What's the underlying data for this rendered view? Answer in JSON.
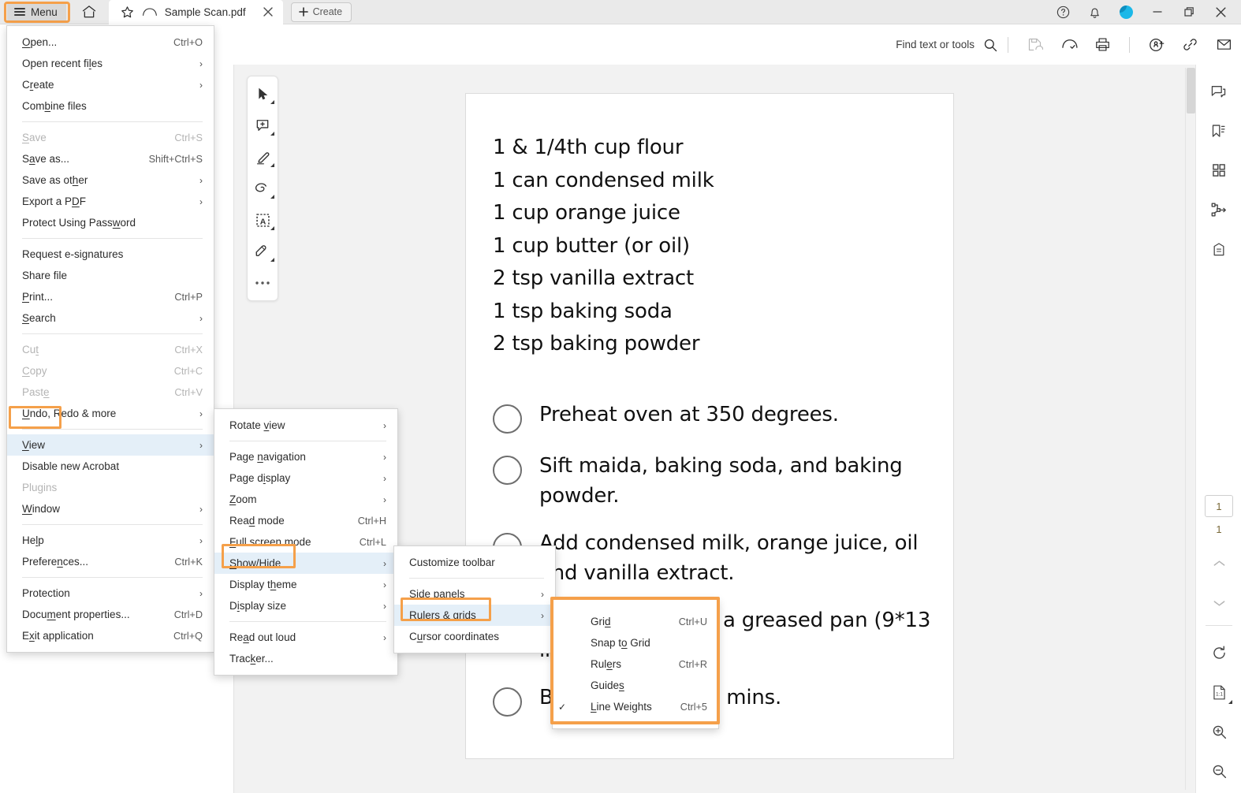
{
  "window": {
    "title_bar": {
      "menu_label": "Menu",
      "home_icon": "home-icon",
      "tab": {
        "star_icon": "star-icon",
        "cloud_icon": "cloud-icon",
        "title": "Sample Scan.pdf",
        "close_icon": "close-icon"
      },
      "create_label": "Create",
      "right_icons": [
        "help-icon",
        "bell-icon",
        "avatar"
      ],
      "window_controls": [
        "minimize",
        "restore",
        "close"
      ]
    },
    "toolbar": {
      "find_placeholder": "Find text or tools",
      "search_icon": "search-icon",
      "icons": [
        "save-to-cloud-icon",
        "cloud-sync-icon",
        "print-icon",
        "request-signature-icon",
        "link-icon",
        "email-icon"
      ]
    }
  },
  "tool_palette": {
    "items": [
      {
        "name": "select-tool",
        "icon": "cursor-arrow-icon",
        "has_caret": true
      },
      {
        "name": "comment-tool",
        "icon": "add-comment-icon",
        "has_caret": true
      },
      {
        "name": "highlight-tool",
        "icon": "highlighter-icon",
        "has_caret": true
      },
      {
        "name": "draw-tool",
        "icon": "lasso-draw-icon",
        "has_caret": true
      },
      {
        "name": "text-select-tool",
        "icon": "select-text-box-icon",
        "has_caret": true
      },
      {
        "name": "fill-sign-tool",
        "icon": "fill-and-sign-icon",
        "has_caret": true
      },
      {
        "name": "more-tools",
        "icon": "ellipsis-icon",
        "has_caret": false
      }
    ]
  },
  "main_menu": {
    "items": [
      {
        "label": "Open...",
        "mnemonic": "O",
        "accel": "Ctrl+O"
      },
      {
        "label": "Open recent files",
        "mnemonic": "l",
        "arrow": true
      },
      {
        "label": "Create",
        "mnemonic": "r",
        "arrow": true
      },
      {
        "label": "Combine files",
        "mnemonic": "b"
      },
      {
        "sep": true
      },
      {
        "label": "Save",
        "mnemonic": "S",
        "accel": "Ctrl+S",
        "disabled": true
      },
      {
        "label": "Save as...",
        "mnemonic": "a",
        "accel": "Shift+Ctrl+S"
      },
      {
        "label": "Save as other",
        "mnemonic": "h",
        "arrow": true
      },
      {
        "label": "Export a PDF",
        "mnemonic": "D",
        "arrow": true
      },
      {
        "label": "Protect Using Password",
        "mnemonic": "w"
      },
      {
        "sep": true
      },
      {
        "label": "Request e-signatures"
      },
      {
        "label": "Share file"
      },
      {
        "label": "Print...",
        "mnemonic": "P",
        "accel": "Ctrl+P"
      },
      {
        "label": "Search",
        "mnemonic": "S",
        "arrow": true
      },
      {
        "sep": true
      },
      {
        "label": "Cut",
        "mnemonic": "t",
        "accel": "Ctrl+X",
        "disabled": true
      },
      {
        "label": "Copy",
        "mnemonic": "C",
        "accel": "Ctrl+C",
        "disabled": true
      },
      {
        "label": "Paste",
        "mnemonic": "e",
        "accel": "Ctrl+V",
        "disabled": true
      },
      {
        "label": "Undo, Redo & more",
        "mnemonic": "U",
        "arrow": true
      },
      {
        "sep": true
      },
      {
        "label": "View",
        "mnemonic": "V",
        "arrow": true,
        "selected": true
      },
      {
        "label": "Disable new Acrobat"
      },
      {
        "label": "Plugins",
        "disabled": true
      },
      {
        "label": "Window",
        "mnemonic": "W",
        "arrow": true
      },
      {
        "sep": true
      },
      {
        "label": "Help",
        "mnemonic": "l",
        "arrow": true
      },
      {
        "label": "Preferences...",
        "mnemonic": "n",
        "accel": "Ctrl+K"
      },
      {
        "sep": true
      },
      {
        "label": "Protection",
        "arrow": true
      },
      {
        "label": "Document properties...",
        "mnemonic": "m",
        "accel": "Ctrl+D"
      },
      {
        "label": "Exit application",
        "mnemonic": "x",
        "accel": "Ctrl+Q"
      }
    ]
  },
  "view_menu": {
    "items": [
      {
        "label": "Rotate view",
        "mnemonic": "v",
        "arrow": true
      },
      {
        "sep": true
      },
      {
        "label": "Page navigation",
        "mnemonic": "n",
        "arrow": true
      },
      {
        "label": "Page display",
        "mnemonic": "i",
        "arrow": true
      },
      {
        "label": "Zoom",
        "mnemonic": "Z",
        "arrow": true
      },
      {
        "label": "Read mode",
        "mnemonic": "d",
        "accel": "Ctrl+H"
      },
      {
        "label": "Full screen mode",
        "mnemonic": "F",
        "accel": "Ctrl+L"
      },
      {
        "label": "Show/Hide",
        "mnemonic": "S",
        "arrow": true,
        "selected": true
      },
      {
        "label": "Display theme",
        "mnemonic": "h",
        "arrow": true
      },
      {
        "label": "Display size",
        "mnemonic": "i",
        "arrow": true
      },
      {
        "sep": true
      },
      {
        "label": "Read out loud",
        "mnemonic": "a",
        "arrow": true
      },
      {
        "label": "Tracker...",
        "mnemonic": "k"
      }
    ]
  },
  "showhide_menu": {
    "items": [
      {
        "label": "Customize toolbar"
      },
      {
        "sep": true
      },
      {
        "label": "Side panels",
        "arrow": true
      },
      {
        "label": "Rulers & grids",
        "mnemonic": "R",
        "arrow": true,
        "selected": true
      },
      {
        "label": "Cursor coordinates",
        "mnemonic": "u"
      }
    ]
  },
  "rulers_grids_menu": {
    "items": [
      {
        "label": "Grid",
        "mnemonic": "d",
        "accel": "Ctrl+U",
        "checked": false
      },
      {
        "label": "Snap to Grid",
        "mnemonic": "o",
        "checked": false
      },
      {
        "label": "Rulers",
        "mnemonic": "e",
        "accel": "Ctrl+R",
        "checked": false
      },
      {
        "label": "Guides",
        "mnemonic": "s",
        "checked": false
      },
      {
        "label": "Line Weights",
        "mnemonic": "L",
        "accel": "Ctrl+5",
        "checked": true
      }
    ]
  },
  "document": {
    "ingredients": [
      "1 & 1/4th cup flour",
      "1 can condensed milk",
      "1 cup orange juice",
      "1 cup butter (or oil)",
      "2 tsp vanilla extract",
      "1 tsp baking soda",
      "2 tsp baking powder"
    ],
    "steps": [
      "Preheat oven at 350 degrees.",
      "Sift maida, baking soda, and baking powder.",
      "Add condensed milk, orange juice, oil and vanilla extract.",
      "Pour the batter in a greased pan (9*13 inch).",
      "Bake for about 40 mins."
    ]
  },
  "right_rail": {
    "top_icons": [
      "comments-panel-icon",
      "bookmarks-panel-icon",
      "page-thumbnails-icon",
      "organize-pages-icon",
      "attachments-icon"
    ],
    "page_current": "1",
    "page_total": "1",
    "nav_up_icon": "chevron-up-icon",
    "nav_down_icon": "chevron-down-icon",
    "bottom_icons": [
      "rotate-icon",
      "fit-page-icon",
      "zoom-in-icon",
      "zoom-out-icon"
    ]
  },
  "colors": {
    "highlight_box": "#F5A04A",
    "menu_selected": "#E4EFF8",
    "titlebar_bg": "#EAEAEA",
    "workspace_bg": "#F2F2F2",
    "accent_avatar": "#1BB8E8"
  }
}
